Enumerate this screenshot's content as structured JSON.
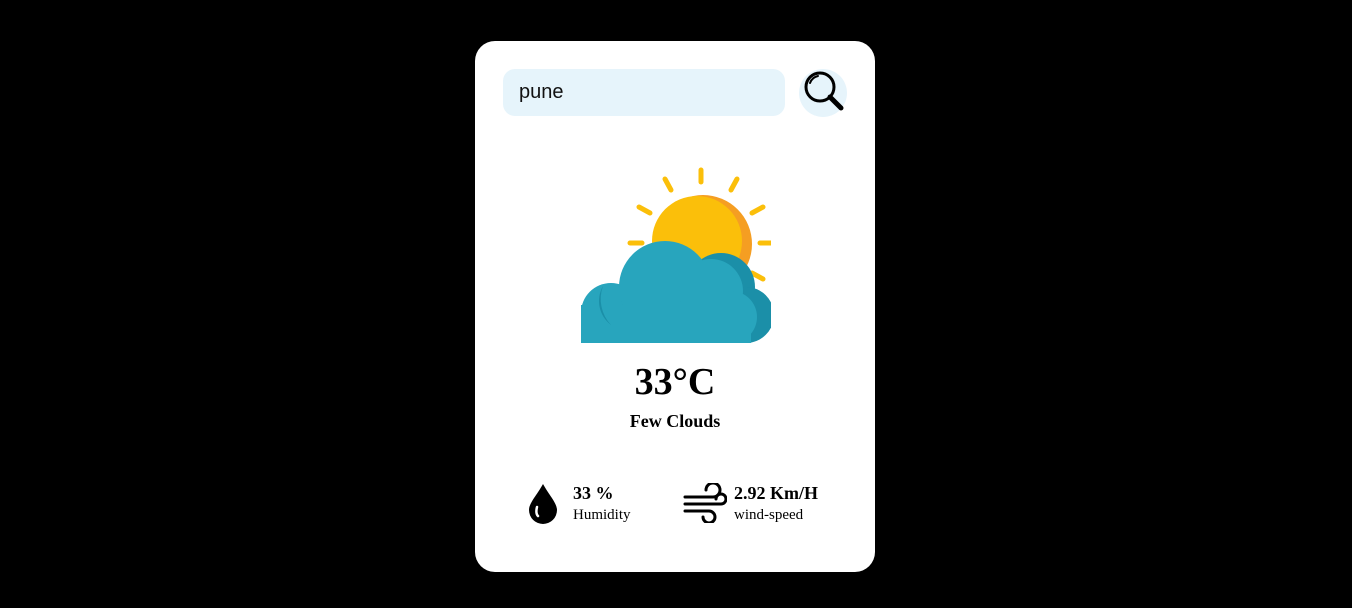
{
  "search": {
    "value": "pune",
    "button_icon": "search-icon"
  },
  "weather": {
    "icon": "sun-behind-cloud-icon",
    "temperature": "33°C",
    "condition": "Few Clouds"
  },
  "details": {
    "humidity": {
      "icon": "water-drop-icon",
      "value": "33 %",
      "label": "Humidity"
    },
    "wind": {
      "icon": "wind-icon",
      "value": "2.92 Km/H",
      "label": "wind-speed"
    }
  },
  "colors": {
    "background": "#000000",
    "card": "#ffffff",
    "input_bg": "#e6f4fb",
    "sun": "#fbbf0a",
    "sun_shade": "#f59e22",
    "cloud": "#28a5bd",
    "cloud_shade": "#1b8fa8"
  }
}
